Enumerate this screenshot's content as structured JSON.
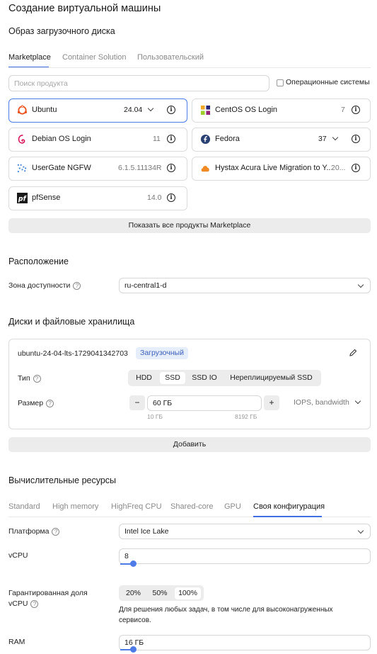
{
  "page": {
    "title": "Создание виртуальной машины"
  },
  "boot_disk": {
    "title": "Образ загрузочного диска",
    "tabs": [
      {
        "label": "Marketplace",
        "active": true
      },
      {
        "label": "Container Solution",
        "active": false
      },
      {
        "label": "Пользовательский",
        "active": false
      }
    ],
    "search": {
      "placeholder": "Поиск продукта",
      "value": ""
    },
    "os_checkbox_label": "Операционные системы",
    "products": [
      {
        "name": "Ubuntu",
        "version": "24.04",
        "has_dropdown": true,
        "selected": true,
        "logo": "ubuntu-logo"
      },
      {
        "name": "CentOS OS Login",
        "version": "7",
        "has_dropdown": false,
        "selected": false,
        "logo": "centos-logo"
      },
      {
        "name": "Debian OS Login",
        "version": "11",
        "has_dropdown": false,
        "selected": false,
        "logo": "debian-logo"
      },
      {
        "name": "Fedora",
        "version": "37",
        "has_dropdown": true,
        "selected": false,
        "logo": "fedora-logo"
      },
      {
        "name": "UserGate NGFW",
        "version": "6.1.5.11134R",
        "has_dropdown": false,
        "selected": false,
        "logo": "usergate-logo"
      },
      {
        "name": "Hystax Acura Live Migration to Y...",
        "version": "20...",
        "has_dropdown": false,
        "selected": false,
        "logo": "hystax-logo"
      },
      {
        "name": "pfSense",
        "version": "14.0",
        "has_dropdown": false,
        "selected": false,
        "logo": "pfsense-logo"
      }
    ],
    "show_all_label": "Показать все продукты Marketplace"
  },
  "location": {
    "title": "Расположение",
    "zone_label": "Зона доступности",
    "zone_value": "ru-central1-d"
  },
  "disks": {
    "title": "Диски и файловые хранилища",
    "disk_name": "ubuntu-24-04-lts-1729041342703",
    "disk_badge": "Загрузочный",
    "type_label": "Тип",
    "types": [
      {
        "label": "HDD",
        "active": false
      },
      {
        "label": "SSD",
        "active": true
      },
      {
        "label": "SSD IO",
        "active": false
      },
      {
        "label": "Нереплицируемый SSD",
        "active": false
      }
    ],
    "size_label": "Размер",
    "size_value": "60 ГБ",
    "size_min": "10 ГБ",
    "size_max": "8192 ГБ",
    "minus": "−",
    "plus": "+",
    "iops_label": "IOPS, bandwidth",
    "add_label": "Добавить"
  },
  "compute": {
    "title": "Вычислительные ресурсы",
    "tabs": [
      {
        "label": "Standard",
        "active": false
      },
      {
        "label": "High memory",
        "active": false
      },
      {
        "label": "HighFreq CPU",
        "active": false
      },
      {
        "label": "Shared-core",
        "active": false
      },
      {
        "label": "GPU",
        "active": false
      },
      {
        "label": "Своя конфигурация",
        "active": true
      }
    ],
    "platform_label": "Платформа",
    "platform_value": "Intel Ice Lake",
    "vcpu_label": "vCPU",
    "vcpu_value": "8",
    "vcpu_slider_fraction": 0.04,
    "guaranteed_label_1": "Гарантированная доля",
    "guaranteed_label_2": "vCPU",
    "guaranteed_options": [
      {
        "label": "20%",
        "active": false
      },
      {
        "label": "50%",
        "active": false
      },
      {
        "label": "100%",
        "active": true
      }
    ],
    "guaranteed_hint_1": "Для решения любых задач, в том числе для высоконагруженных",
    "guaranteed_hint_2": "сервисов.",
    "ram_label": "RAM",
    "ram_value": "16 ГБ",
    "ram_slider_fraction": 0.04
  },
  "colors": {
    "accent": "#4f7be8",
    "badge_bg": "#e6eefc"
  }
}
